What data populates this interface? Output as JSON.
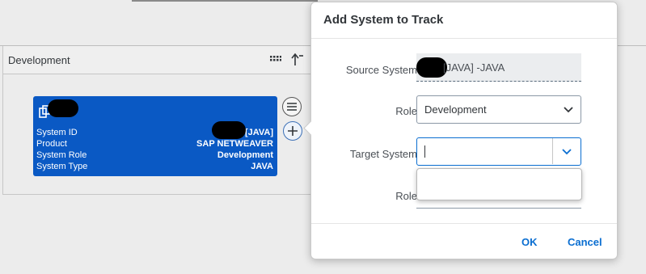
{
  "lane": {
    "title": "Development"
  },
  "card": {
    "rows": [
      {
        "key": "System ID",
        "value": "[JAVA]"
      },
      {
        "key": "Product",
        "value": "SAP NETWEAVER"
      },
      {
        "key": "System Role",
        "value": "Development"
      },
      {
        "key": "System Type",
        "value": "JAVA"
      }
    ]
  },
  "dialog": {
    "title": "Add System to Track",
    "source_label": "Source System",
    "source_value": "[JAVA] -JAVA",
    "role_label": "Role",
    "role_value": "Development",
    "target_label": "Target System",
    "target_value": "",
    "role2_label": "Role",
    "ok_label": "OK",
    "cancel_label": "Cancel"
  },
  "colors": {
    "card_bg": "#0a59c4",
    "accent": "#0a6ed1"
  },
  "icons": {
    "lane_layout": "grid-icon",
    "lane_sort": "sort-ascending-icon",
    "card_type": "system-icon",
    "menu": "menu-icon",
    "add": "add-icon",
    "dropdown": "chevron-down-icon"
  }
}
